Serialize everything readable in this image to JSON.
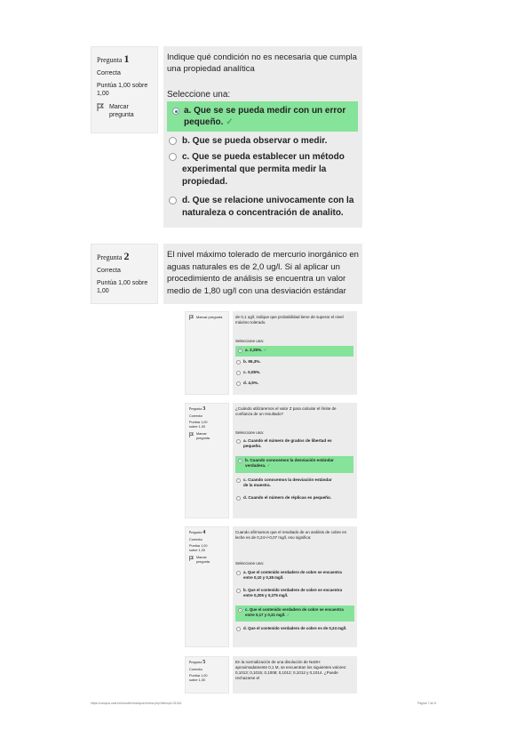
{
  "q1": {
    "label": "Pregunta",
    "num": "1",
    "status": "Correcta",
    "score": "Puntúa 1,00 sobre 1,00",
    "flag": "Marcar pregunta",
    "text": "Indique qué condición no es necesaria que cumpla una propiedad analítica",
    "select": "Seleccione una:",
    "options": [
      "a. Que se se pueda medir con un error pequeño.",
      "b. Que se pueda observar o medir.",
      "c. Que se pueda establecer un método experimental que permita medir la propiedad.",
      "d. Que se relacione univocamente con la naturaleza o concentración de analito."
    ]
  },
  "q2": {
    "label": "Pregunta",
    "num": "2",
    "status": "Correcta",
    "score": "Puntúa 1,00 sobre 1,00",
    "text": "El nivel máximo tolerado de mercurio inorgánico en aguas naturales es de 2,0 ug/l. Si al aplicar un procedimiento de análisis se encuentra un valor medio de 1,80 ug/l con una desviación estándar",
    "flag": "Marcar pregunta",
    "text_cont": "de 0,1 ug/l, indique que probabilidad tiene de superar el nivel máximo tolerado.",
    "select": "Seleccione una:",
    "options": [
      "a. 2,25%.",
      "b. 95,3%.",
      "c. 0,05%.",
      "d. 4,5%."
    ]
  },
  "q3": {
    "label": "Pregunta",
    "num": "3",
    "status": "Correcta",
    "score": "Puntúa 1,00 sobre 1,00",
    "flag": "Marcar pregunta",
    "text": "¿Cuándo utilizaremos el valor Z para calcular el límite de confianza de un resultado?",
    "select": "Seleccione una:",
    "options": [
      "a. Cuando el número de grados de libertad es pequeño.",
      "b. Cuando conocemos la desviación estándar verdadera.",
      "c. Cuando conocemos la desviación estándar de la muestra.",
      "d. Cuando el número de réplicas es pequeño."
    ]
  },
  "q4": {
    "label": "Pregunta",
    "num": "4",
    "status": "Correcta",
    "score": "Puntúa 1,00 sobre 1,00",
    "flag": "Marcar pregunta",
    "text": "Cuando afirmamos que el resultado de un análisis de cobre en leche es de 0,24+/-0,07 mg/l, eso significa:",
    "select": "Seleccione una:",
    "options": [
      "a. Que el contenido verdadero de cobre se encuentra entre 0,10 y 0,38 mg/l.",
      "b. Que el contenido verdadero de cobre se encuentra entre 0,205 y 0,275 mg/l.",
      "c. Que el contenido verdadero de cobre se encuentra entre 0,17 y 0,31 mg/l.",
      "d. Que el contenido verdadero de cobre es de 0,24 mg/l."
    ]
  },
  "q5": {
    "label": "Pregunta",
    "num": "5",
    "status": "Correcta",
    "score": "Puntúa 1,00 sobre 1,00",
    "text": "En la normalización de una disolución de NaOH aproximadamente 0,1 M, se encuentran los siguientes valores: 0,1013; 0,1015; 0,1008; 0,1012; 0,1012 y 0,1014. ¿Puede rechazarse el"
  },
  "footer": {
    "left": "https://campus.usal.es/moodle/mod/quiz/review.php?attempt=31316",
    "right": "Página 7 de 8"
  },
  "colors": {
    "correct_bg": "#86e39a",
    "check": "#3fb34f",
    "info_bg": "#f3f3f3",
    "question_bg": "#ececec"
  }
}
